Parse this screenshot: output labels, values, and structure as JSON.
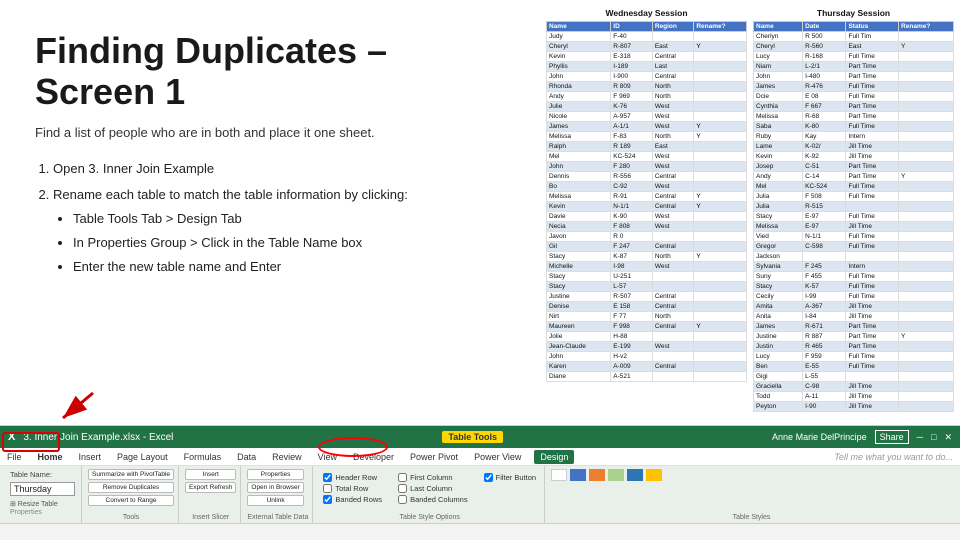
{
  "slide": {
    "title": "Finding Duplicates – Screen 1",
    "subtitle": "Find a list of people who are in both and place it one sheet.",
    "steps": [
      {
        "number": "1.",
        "text": "Open 3. Inner Join Example"
      },
      {
        "number": "2.",
        "text": "Rename each table to match the table information by clicking:",
        "bullets": [
          "Table Tools Tab > Design Tab",
          "In Properties Group > Click in the Table Name box",
          "Enter the new table name and Enter"
        ]
      }
    ]
  },
  "wednesday_session": {
    "title": "Wednesday Session",
    "headers": [
      "Name",
      "ID",
      "Region",
      "Rename?"
    ],
    "rows": [
      [
        "Judy",
        "F-40",
        "",
        ""
      ],
      [
        "Cheryl",
        "R-807",
        "East",
        "Y"
      ],
      [
        "Kevin",
        "E-318",
        "Central",
        ""
      ],
      [
        "Phyllis",
        "I-189",
        "Last",
        ""
      ],
      [
        "John",
        "I-900",
        "Central",
        ""
      ],
      [
        "Rhonda",
        "R 809",
        "North",
        ""
      ],
      [
        "Andy",
        "F 969",
        "North",
        ""
      ],
      [
        "Julie",
        "K-76",
        "West",
        ""
      ],
      [
        "Nicole",
        "A-957",
        "West",
        ""
      ],
      [
        "James",
        "A-1/1",
        "West",
        "Y"
      ],
      [
        "Melissa",
        "F-83",
        "North",
        "Y"
      ],
      [
        "Ralph",
        "R 189",
        "East",
        ""
      ],
      [
        "Mel",
        "KC-524",
        "West",
        ""
      ],
      [
        "John",
        "F 280",
        "West",
        ""
      ],
      [
        "Dennis",
        "R-556",
        "Central",
        ""
      ],
      [
        "Bo",
        "C-92",
        "West",
        ""
      ],
      [
        "Melissa",
        "R-91",
        "Central",
        "Y"
      ],
      [
        "Kevin",
        "N-1/1",
        "Central",
        "Y"
      ],
      [
        "Davie",
        "K-90",
        "West",
        ""
      ],
      [
        "Necia",
        "F 808",
        "West",
        ""
      ],
      [
        "Javon",
        "R 0",
        "",
        ""
      ],
      [
        "Gil",
        "F 247",
        "Central",
        ""
      ],
      [
        "Stacy",
        "K-87",
        "North",
        "Y"
      ],
      [
        "Michelle",
        "I-98",
        "West",
        ""
      ],
      [
        "Stacy",
        "U-251",
        "",
        ""
      ],
      [
        "Stacy",
        "L-57",
        "",
        ""
      ],
      [
        "Justine",
        "R-507",
        "Central",
        ""
      ],
      [
        "Denise",
        "E 158",
        "Central",
        ""
      ],
      [
        "Nirt",
        "F 77",
        "North",
        ""
      ],
      [
        "Maureen",
        "F 998",
        "Central",
        "Y"
      ],
      [
        "Jolie",
        "H-88",
        "",
        ""
      ],
      [
        "Jean-Claude",
        "E-199",
        "West",
        ""
      ],
      [
        "John",
        "H-v2",
        "",
        ""
      ],
      [
        "Karen",
        "A-009",
        "Central",
        ""
      ],
      [
        "Diane",
        "A-521",
        "",
        ""
      ]
    ]
  },
  "thursday_session": {
    "title": "Thursday Session",
    "headers": [
      "Name",
      "Date",
      "Status",
      "Rename?"
    ],
    "rows": [
      [
        "Cherlyn",
        "R 500",
        "Full Tim",
        ""
      ],
      [
        "Cheryl",
        "R-560",
        "East",
        "Y"
      ],
      [
        "Lucy",
        "R-168",
        "Full Time",
        ""
      ],
      [
        "Niam",
        "L-2/1",
        "Part Time",
        ""
      ],
      [
        "John",
        "I-480",
        "Part Time",
        ""
      ],
      [
        "James",
        "R-476",
        "Full Time",
        ""
      ],
      [
        "Dcie",
        "E 08",
        "Full Time",
        ""
      ],
      [
        "Cynthia",
        "F 667",
        "Part Time",
        ""
      ],
      [
        "Melissa",
        "R-68",
        "Part Time",
        ""
      ],
      [
        "Saba",
        "K-80",
        "Full Time",
        ""
      ],
      [
        "Ruby",
        "Kay",
        "Intern",
        ""
      ],
      [
        "Lame",
        "K-02/",
        "Jill Time",
        ""
      ],
      [
        "Kevin",
        "K-92",
        "Jill Time",
        ""
      ],
      [
        "Josep",
        "C-51",
        "Part Time",
        ""
      ],
      [
        "Andy",
        "C-14",
        "Part Time",
        "Y"
      ],
      [
        "Mel",
        "KC-524",
        "Full Time",
        ""
      ],
      [
        "Julia",
        "F 508",
        "Full Time",
        ""
      ],
      [
        "Julia",
        "R-515",
        "",
        ""
      ],
      [
        "Stacy",
        "E-97",
        "Full Time",
        ""
      ],
      [
        "Melissa",
        "E-97",
        "Jill Time",
        ""
      ],
      [
        "Vied",
        "N-1/1",
        "Full Time",
        ""
      ],
      [
        "Gregor",
        "C-598",
        "Full Time",
        ""
      ],
      [
        "Jackson",
        "",
        "",
        ""
      ],
      [
        "Sylvania",
        "F 245",
        "Intern",
        ""
      ],
      [
        "Suny",
        "F 455",
        "Full Time",
        ""
      ],
      [
        "Stacy",
        "K-57",
        "Full Time",
        ""
      ],
      [
        "Cecily",
        "I-99",
        "Full Time",
        ""
      ],
      [
        "Amita",
        "A-367",
        "Jill Time",
        ""
      ],
      [
        "Anita",
        "I-84",
        "Jill Time",
        ""
      ],
      [
        "James",
        "R-671",
        "Part Time",
        ""
      ],
      [
        "Justine",
        "R 887",
        "Part Time",
        "Y"
      ],
      [
        "Justin",
        "R 465",
        "Part Time",
        ""
      ],
      [
        "Lucy",
        "F 959",
        "Full Time",
        ""
      ],
      [
        "Ben",
        "E-55",
        "Full Time",
        ""
      ],
      [
        "Gigi",
        "L-55",
        "",
        ""
      ],
      [
        "Graciella",
        "C-98",
        "Jill Time",
        ""
      ],
      [
        "Todd",
        "A-11",
        "Jill Time",
        ""
      ],
      [
        "Peyton",
        "I-90",
        "Jill Time",
        ""
      ]
    ]
  },
  "excel": {
    "title_bar": "3. Inner Join Example.xlsx - Excel",
    "tool_tab": "Table Tools",
    "active_tab": "Design",
    "tabs": [
      "File",
      "Home",
      "Insert",
      "Page Layout",
      "Formulas",
      "Data",
      "Review",
      "View",
      "Developer",
      "Power Pivot",
      "Power View"
    ],
    "tell_me": "Tell me what you want to do...",
    "user": "Anne Marie DelPrincipe",
    "groups": {
      "properties": {
        "label": "Properties",
        "table_name_label": "Table Name:",
        "table_name_value": "Thursday"
      },
      "tools": {
        "label": "Tools",
        "buttons": [
          "Summarize with PivotTable",
          "Remove Duplicates",
          "Convert to Range"
        ]
      },
      "insert_slicer": {
        "label": "Insert Slicer",
        "buttons": [
          "Insert",
          "Export Refresh"
        ]
      },
      "external_table_data": {
        "label": "External Table Data",
        "buttons": [
          "Properties",
          "Open in Browser",
          "Unlink"
        ]
      },
      "table_style_options": {
        "label": "Table Style Options",
        "checkboxes": [
          "Header Row",
          "First Column",
          "Filter Button",
          "Total Row",
          "Last Column",
          "Banded Rows",
          "Banded Columns"
        ]
      },
      "table_styles": {
        "label": "Table Styles"
      }
    }
  },
  "arrow": {
    "color": "#cc0000"
  }
}
